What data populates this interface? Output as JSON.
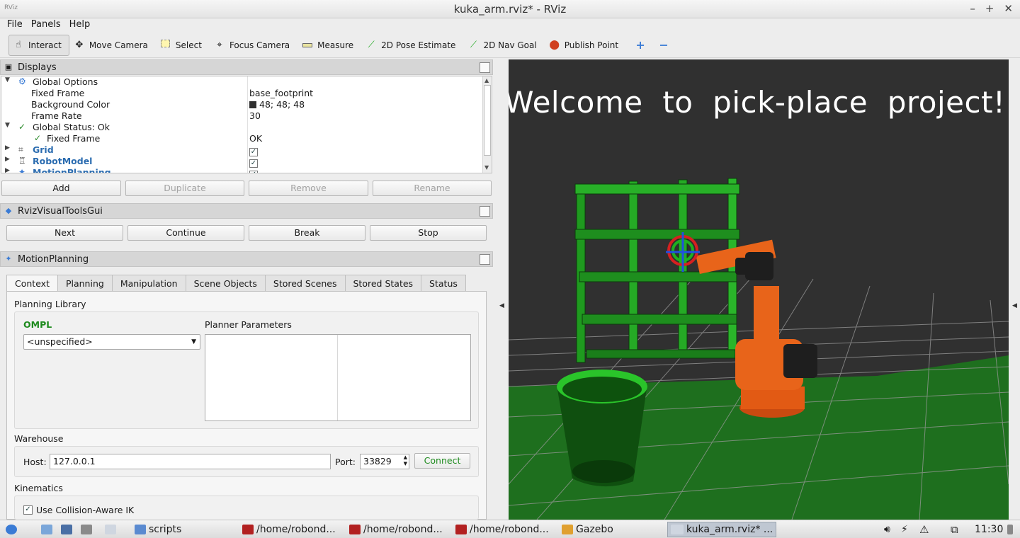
{
  "window": {
    "title": "kuka_arm.rviz* - RViz",
    "icon_label": "RViz"
  },
  "menu": [
    "File",
    "Panels",
    "Help"
  ],
  "toolbar": {
    "tools": [
      {
        "label": "Interact",
        "icon": "hand-icon"
      },
      {
        "label": "Move Camera",
        "icon": "move-camera-icon"
      },
      {
        "label": "Select",
        "icon": "select-icon"
      },
      {
        "label": "Focus Camera",
        "icon": "focus-camera-icon"
      },
      {
        "label": "Measure",
        "icon": "ruler-icon"
      },
      {
        "label": "2D Pose Estimate",
        "icon": "pose-arrow-icon"
      },
      {
        "label": "2D Nav Goal",
        "icon": "nav-goal-icon"
      },
      {
        "label": "Publish Point",
        "icon": "map-pin-icon"
      }
    ]
  },
  "displays": {
    "title": "Displays",
    "rows": [
      {
        "label": "Global Options",
        "value": ""
      },
      {
        "label": "Fixed Frame",
        "value": "base_footprint"
      },
      {
        "label": "Background Color",
        "value": "48; 48; 48"
      },
      {
        "label": "Frame Rate",
        "value": "30"
      },
      {
        "label": "Global Status: Ok",
        "value": ""
      },
      {
        "label": "Fixed Frame",
        "value": "OK"
      },
      {
        "label": "Grid",
        "value": ""
      },
      {
        "label": "RobotModel",
        "value": ""
      },
      {
        "label": "MotionPlanning",
        "value": ""
      }
    ],
    "background_color": "#303030",
    "buttons": {
      "add": "Add",
      "duplicate": "Duplicate",
      "remove": "Remove",
      "rename": "Rename"
    }
  },
  "visual_tools": {
    "title": "RvizVisualToolsGui",
    "buttons": {
      "next": "Next",
      "continue": "Continue",
      "break": "Break",
      "stop": "Stop"
    }
  },
  "motion_planning": {
    "title": "MotionPlanning",
    "tabs": [
      "Context",
      "Planning",
      "Manipulation",
      "Scene Objects",
      "Stored Scenes",
      "Stored States",
      "Status"
    ],
    "active_tab": "Context",
    "planning_library": {
      "heading": "Planning Library",
      "library": "OMPL",
      "planner": "<unspecified>",
      "params_heading": "Planner Parameters"
    },
    "warehouse": {
      "heading": "Warehouse",
      "host_label": "Host:",
      "host": "127.0.0.1",
      "port_label": "Port:",
      "port": "33829",
      "connect": "Connect"
    },
    "kinematics": {
      "heading": "Kinematics",
      "collision_aware": "Use Collision-Aware IK",
      "collision_aware_checked": true
    }
  },
  "viewport": {
    "welcome_text": "Welcome  to  pick-place  project!"
  },
  "taskbar": {
    "items": [
      {
        "label": "scripts",
        "icon": "folder-icon"
      },
      {
        "label": "/home/robond...",
        "icon": "terminal-icon"
      },
      {
        "label": "/home/robond...",
        "icon": "terminal-icon"
      },
      {
        "label": "/home/robond...",
        "icon": "terminal-icon"
      },
      {
        "label": "Gazebo",
        "icon": "gazebo-icon"
      },
      {
        "label": "kuka_arm.rviz* ...",
        "icon": "rviz-icon"
      }
    ],
    "clock": "11:30"
  }
}
